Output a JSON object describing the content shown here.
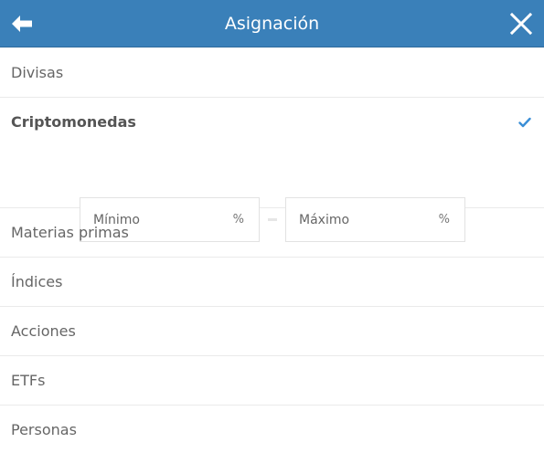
{
  "header": {
    "title": "Asignación",
    "background_color": "#3a80b9",
    "back_icon": "arrow-left-icon",
    "close_icon": "close-icon"
  },
  "categories": [
    {
      "label": "Divisas",
      "selected": false
    },
    {
      "label": "Criptomonedas",
      "selected": true
    },
    {
      "label": "Materias primas",
      "selected": false
    },
    {
      "label": "Índices",
      "selected": false
    },
    {
      "label": "Acciones",
      "selected": false
    },
    {
      "label": "ETFs",
      "selected": false
    },
    {
      "label": "Personas",
      "selected": false
    }
  ],
  "range": {
    "min_placeholder": "Mínimo",
    "min_value": "",
    "max_placeholder": "Máximo",
    "max_value": "",
    "unit": "%"
  },
  "accent_color": "#3a8ed6"
}
